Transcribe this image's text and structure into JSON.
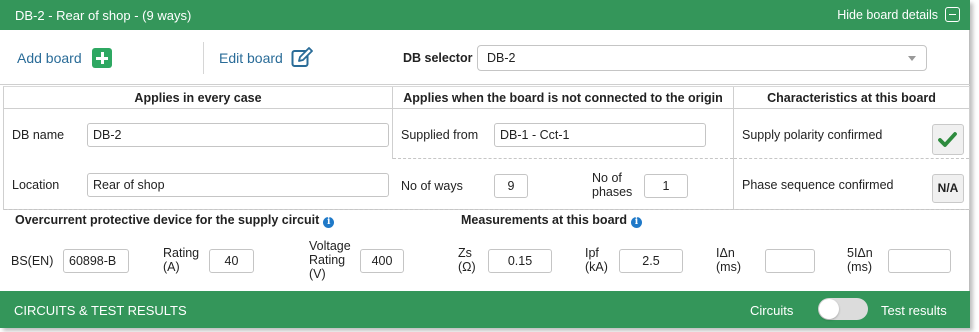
{
  "header": {
    "title": "DB-2 - Rear of shop - (9 ways)",
    "hide_label": "Hide board details"
  },
  "toolbar": {
    "add_board": "Add board",
    "edit_board": "Edit board",
    "db_selector_label": "DB selector",
    "db_selector_value": "DB-2"
  },
  "columns": {
    "every_case": "Applies in every case",
    "not_origin": "Applies when the board is not connected to the origin",
    "characteristics": "Characteristics at this board"
  },
  "fields": {
    "db_name_label": "DB name",
    "db_name_value": "DB-2",
    "location_label": "Location",
    "location_value": "Rear of shop",
    "supplied_from_label": "Supplied from",
    "supplied_from_value": "DB-1 - Cct-1",
    "no_of_ways_label": "No of ways",
    "no_of_ways_value": "9",
    "no_of_phases_label_1": "No of",
    "no_of_phases_label_2": "phases",
    "no_of_phases_value": "1",
    "supply_polarity_label": "Supply polarity confirmed",
    "phase_sequence_label": "Phase sequence confirmed",
    "phase_sequence_value": "N/A"
  },
  "ocpd": {
    "title": "Overcurrent protective device for the supply circuit",
    "bs_label": "BS(EN)",
    "bs_value": "60898-B",
    "rating_l1": "Rating",
    "rating_l2": "(A)",
    "rating_value": "40",
    "voltage_l1": "Voltage",
    "voltage_l2": "Rating",
    "voltage_l3": "(V)",
    "voltage_value": "400"
  },
  "measurements": {
    "title": "Measurements at this board",
    "zs_l1": "Zs",
    "zs_l2": "(Ω)",
    "zs_value": "0.15",
    "ipf_l1": "Ipf",
    "ipf_l2": "(kA)",
    "ipf_value": "2.5",
    "idn_l1": "IΔn",
    "idn_l2": "(ms)",
    "idn_value": "",
    "fidn_l1": "5IΔn",
    "fidn_l2": "(ms)",
    "fidn_value": ""
  },
  "footer": {
    "title": "CIRCUITS & TEST RESULTS",
    "circuits": "Circuits",
    "test_results": "Test results"
  },
  "colors": {
    "green": "#34965a",
    "link": "#2a6c98",
    "check": "#2e8b3e"
  },
  "icons": [
    "plus-square-icon",
    "edit-icon",
    "minus-square-icon",
    "check-icon",
    "info-icon",
    "dropdown-arrow-icon"
  ]
}
